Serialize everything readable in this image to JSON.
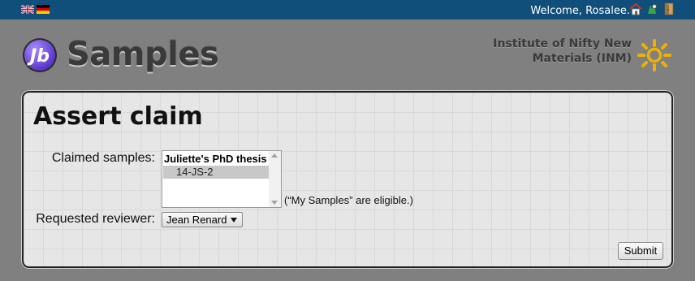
{
  "topbar": {
    "languages": [
      {
        "name": "uk-flag-icon"
      },
      {
        "name": "germany-flag-icon"
      }
    ],
    "welcome_text": "Welcome, Rosalee.",
    "icons": [
      "home-icon",
      "feedback-icon",
      "logout-icon"
    ]
  },
  "header": {
    "logo_badge": "Jb",
    "logo_text": "Samples",
    "institute_line1": "Institute of Nifty New",
    "institute_line2": "Materials (INM)"
  },
  "main": {
    "title": "Assert claim",
    "claimed_samples_label": "Claimed samples:",
    "samples_list": {
      "group_label": "Juliette's PhD thesis",
      "options": [
        "14-JS-2"
      ]
    },
    "eligibility_note": "(“My Samples” are eligible.)",
    "reviewer_label": "Requested reviewer:",
    "reviewer_selected": "Jean Renard",
    "submit_label": "Submit"
  },
  "colors": {
    "topbar": "#0f4f7a",
    "background": "#808080",
    "panel": "#e6e6e6",
    "logo_purple": "#6b49d8",
    "sun_orange": "#f0b000"
  }
}
